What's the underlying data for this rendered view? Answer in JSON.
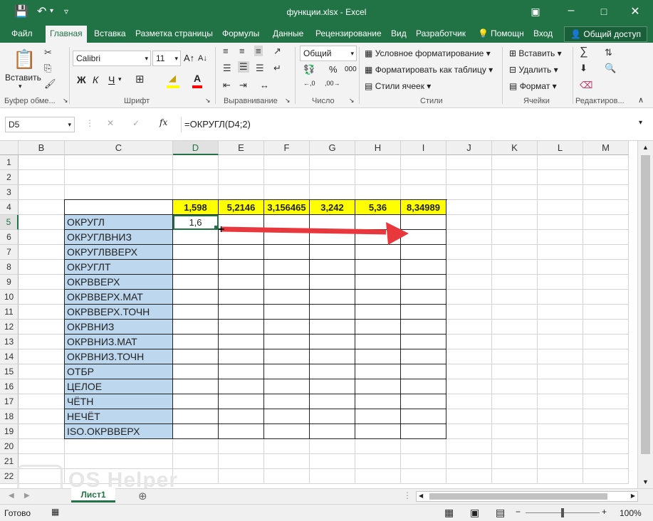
{
  "window": {
    "title": "функции.xlsx - Excel"
  },
  "tabs": [
    "Файл",
    "Главная",
    "Вставка",
    "Разметка страницы",
    "Формулы",
    "Данные",
    "Рецензирование",
    "Вид",
    "Разработчик"
  ],
  "tell": "Помощн",
  "signin": "Вход",
  "share": "Общий доступ",
  "clipboard": {
    "paste": "Вставить",
    "group": "Буфер обме..."
  },
  "font": {
    "name": "Calibri",
    "size": "11",
    "group": "Шрифт",
    "bold": "Ж",
    "italic": "К",
    "underline": "Ч"
  },
  "align_group": "Выравнивание",
  "number": {
    "format": "Общий",
    "group": "Число",
    "percent": "%",
    "thousands": "000"
  },
  "styles": {
    "cond": "Условное форматирование",
    "table": "Форматировать как таблицу",
    "cell": "Стили ячеек",
    "group": "Стили"
  },
  "cells": {
    "insert": "Вставить",
    "delete": "Удалить",
    "format": "Формат",
    "group": "Ячейки"
  },
  "edit_group": "Редактиров...",
  "formula": {
    "namebox": "D5",
    "fx": "fx",
    "content": "=ОКРУГЛ(D4;2)"
  },
  "columns": [
    "B",
    "C",
    "D",
    "E",
    "F",
    "G",
    "H",
    "I",
    "J",
    "K",
    "L",
    "M"
  ],
  "rows": [
    "1",
    "2",
    "3",
    "4",
    "5",
    "6",
    "7",
    "8",
    "9",
    "10",
    "11",
    "12",
    "13",
    "14",
    "15",
    "16",
    "17",
    "18",
    "19",
    "20",
    "21",
    "22"
  ],
  "row4_values": [
    "1,598",
    "5,2146",
    "3,156465",
    "3,242",
    "5,36",
    "8,34989"
  ],
  "d5": "1,6",
  "functions": [
    "ОКРУГЛ",
    "ОКРУГЛВНИЗ",
    "ОКРУГЛВВЕРХ",
    "ОКРУГЛТ",
    "ОКРВВЕРХ",
    "ОКРВВЕРХ.МАТ",
    "ОКРВВЕРХ.ТОЧН",
    "ОКРВНИЗ",
    "ОКРВНИЗ.МАТ",
    "ОКРВНИЗ.ТОЧН",
    "ОТБР",
    "ЦЕЛОЕ",
    "ЧЁТН",
    "НЕЧЁТ",
    "ISO.ОКРВВЕРХ"
  ],
  "sheet_tab": "Лист1",
  "status": {
    "ready": "Готово",
    "zoom": "100%"
  },
  "watermark": "OS Helper",
  "colors": {
    "excel_green": "#217346",
    "fn_fill": "#bdd7ee",
    "yellow": "#ffff00",
    "arrow": "#e8383d"
  }
}
